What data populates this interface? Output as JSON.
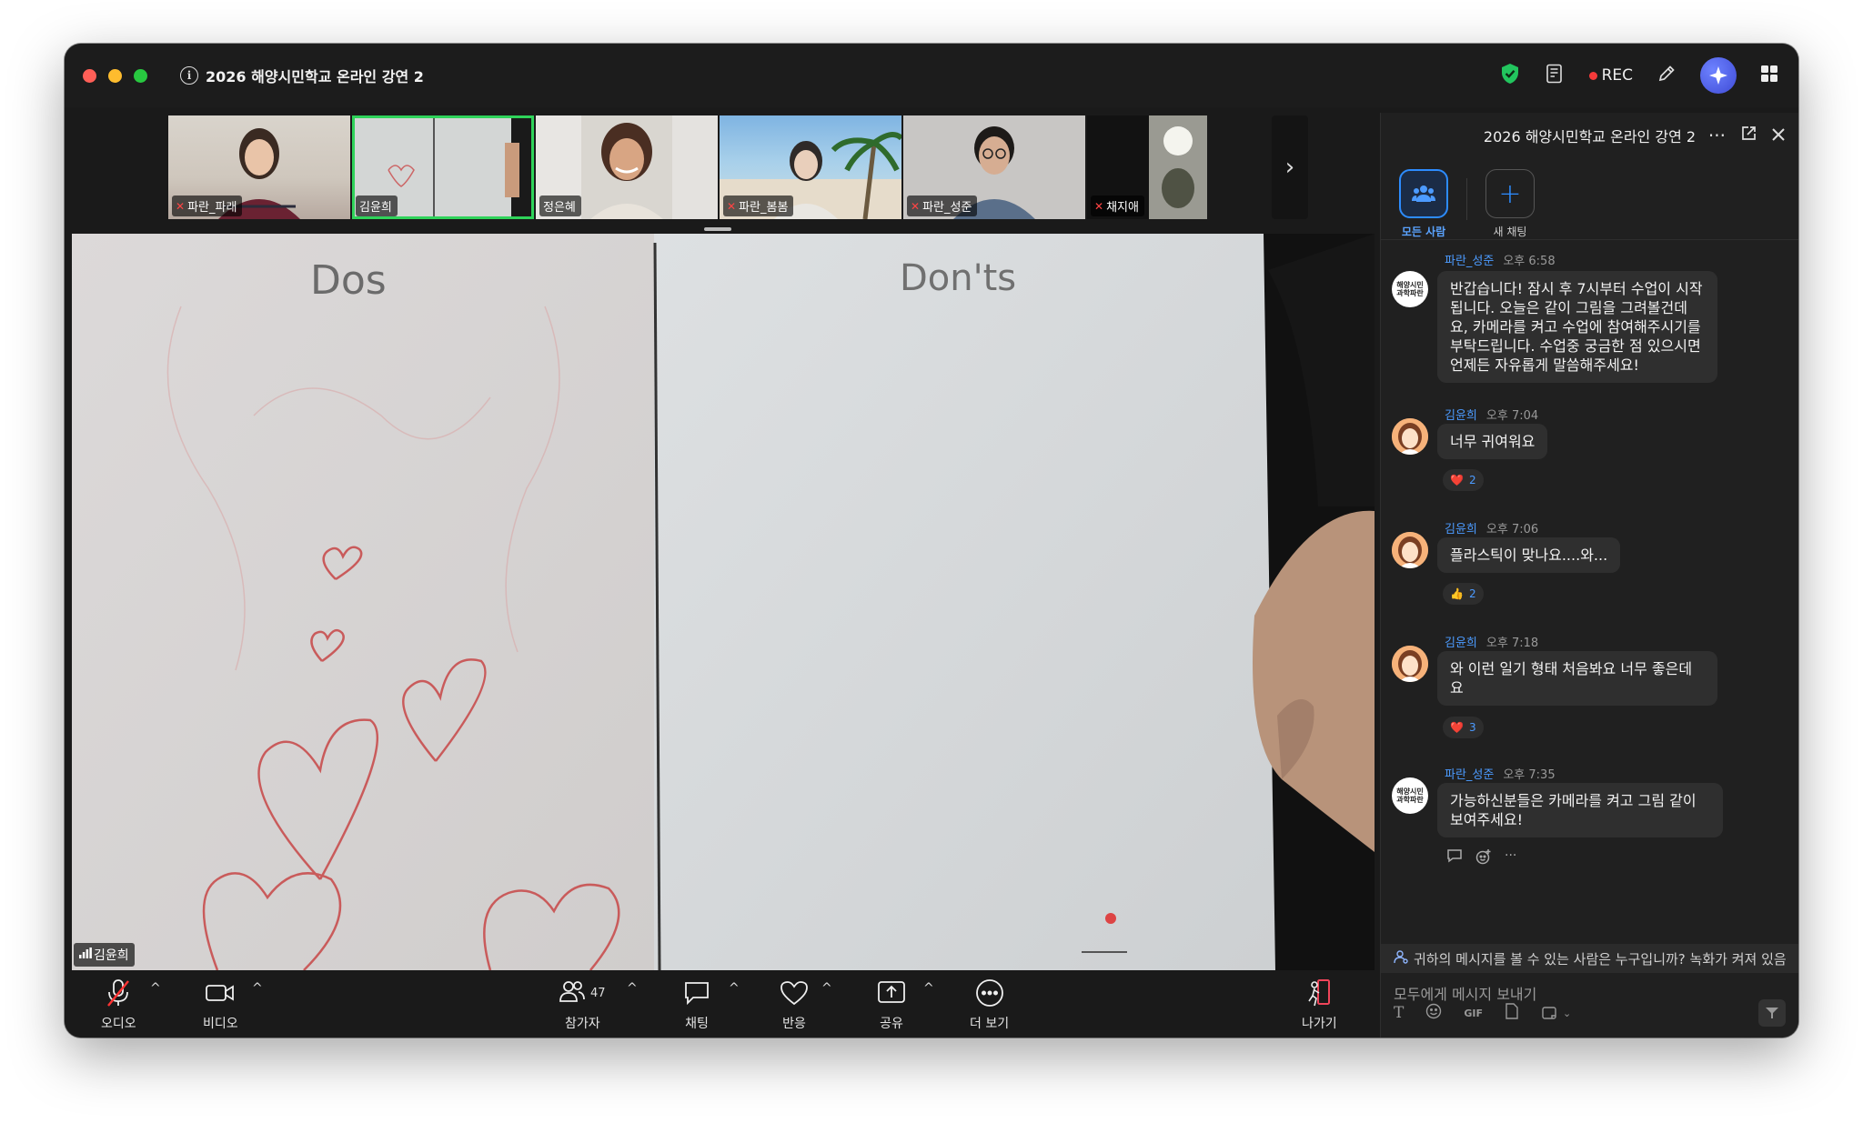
{
  "meeting": {
    "title": "2026 해양시민학교 온라인 강연 2",
    "rec_label": "REC"
  },
  "participants_strip": [
    {
      "name": "파란_파래",
      "muted": true
    },
    {
      "name": "김윤희",
      "muted": false,
      "active": true
    },
    {
      "name": "정은혜",
      "muted": false
    },
    {
      "name": "파란_봄봄",
      "muted": true
    },
    {
      "name": "파란_성준",
      "muted": true
    },
    {
      "name": "채지애",
      "muted": true
    }
  ],
  "main_video": {
    "speaker": "김윤희",
    "board_left": "Dos",
    "board_right": "Don'ts"
  },
  "toolbar": {
    "audio": "오디오",
    "video": "비디오",
    "participants": "참가자",
    "participants_count": "47",
    "chat": "채팅",
    "reactions": "반응",
    "share": "공유",
    "more": "더 보기",
    "leave": "나가기"
  },
  "chat": {
    "header_title": "2026 해양시민학교 온라인 강연 2",
    "tab_all": "모든 사람",
    "tab_new": "새 채팅",
    "avatar_logo_text": "해양시민과학파란",
    "messages": [
      {
        "sender": "파란_성준",
        "time": "오후 6:58",
        "text": "반갑습니다! 잠시 후 7시부터 수업이 시작됩니다. 오늘은 같이 그림을 그려볼건데요, 카메라를 켜고 수업에 참여해주시기를 부탁드립니다. 수업중 궁금한 점 있으시면 언제든 자유롭게 말씀해주세요!"
      },
      {
        "sender": "김윤희",
        "time": "오후 7:04",
        "text": "너무 귀여워요",
        "reaction_emoji": "❤️",
        "reaction_count": "2"
      },
      {
        "sender": "김윤희",
        "time": "오후 7:06",
        "text": "플라스틱이 맞나요....와...",
        "reaction_emoji": "👍",
        "reaction_count": "2"
      },
      {
        "sender": "김윤희",
        "time": "오후 7:18",
        "text": "와 이런 일기 형태 처음봐요 너무 좋은데요",
        "reaction_emoji": "❤️",
        "reaction_count": "3"
      },
      {
        "sender": "파란_성준",
        "time": "오후 7:35",
        "text": "가능하신분들은 카메라를 켜고 그림 같이 보여주세요!"
      }
    ],
    "privacy_notice": "귀하의 메시지를 볼 수 있는 사람은 누구입니까? 녹화가 켜져 있음",
    "input_placeholder": "모두에게 메시지 보내기",
    "gif_label": "GIF"
  }
}
